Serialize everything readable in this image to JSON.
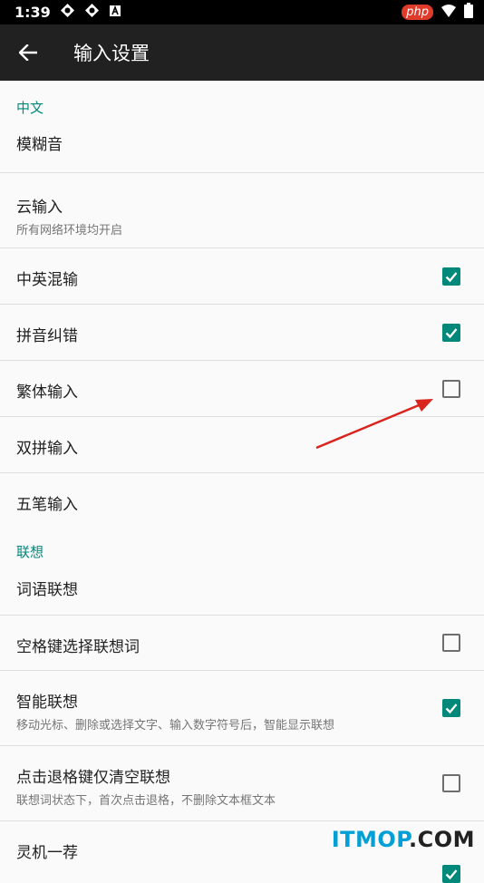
{
  "statusbar": {
    "time": "1:39",
    "badge": "php"
  },
  "toolbar": {
    "title": "输入设置"
  },
  "sections": {
    "chinese": "中文",
    "assoc": "联想"
  },
  "rows": {
    "fuzzy": {
      "title": "模糊音"
    },
    "cloud": {
      "title": "云输入",
      "summary": "所有网络环境均开启"
    },
    "mixed": {
      "title": "中英混输",
      "checked": true
    },
    "pinyin_correct": {
      "title": "拼音纠错",
      "checked": true
    },
    "traditional": {
      "title": "繁体输入",
      "checked": false
    },
    "shuangpin": {
      "title": "双拼输入"
    },
    "wubi": {
      "title": "五笔输入"
    },
    "word_assoc": {
      "title": "词语联想"
    },
    "space_select": {
      "title": "空格键选择联想词",
      "checked": false
    },
    "smart_assoc": {
      "title": "智能联想",
      "summary": "移动光标、删除或选择文字、输入数字符号后，智能显示联想",
      "checked": true
    },
    "backspace_clear": {
      "title": "点击退格键仅清空联想",
      "summary": "联想词状态下，首次点击退格，不删除文本框文本",
      "checked": false
    },
    "lingji": {
      "title": "灵机一荐",
      "checked": true
    }
  },
  "watermark": {
    "a": "ITMOP",
    "b": ".COM"
  },
  "colors": {
    "accent": "#00897b",
    "toolbar": "#212121",
    "arrow": "#d9231d"
  }
}
